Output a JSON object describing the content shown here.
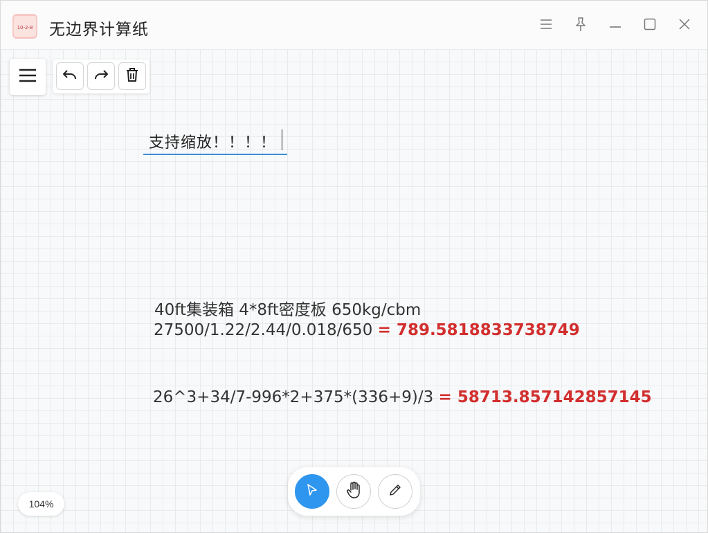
{
  "window": {
    "title": "无边界计算纸",
    "icon_text": "10-2-8"
  },
  "title_buttons": [
    "menu-icon",
    "pin-icon",
    "minimize-icon",
    "maximize-icon",
    "close-icon"
  ],
  "toolbar": [
    "undo-icon",
    "redo-icon",
    "trash-icon"
  ],
  "canvas": {
    "editing_text": "支持缩放！！！！",
    "lines": [
      {
        "expr": "40ft集装箱 4*8ft密度板 650kg/cbm",
        "result": ""
      },
      {
        "expr": "27500/1.22/2.44/0.018/650",
        "result": "= 789.5818833738749"
      },
      {
        "expr": "26^3+34/7-996*2+375*(336+9)/3",
        "result": "= 58713.857142857145"
      }
    ]
  },
  "zoom": "104%",
  "tools": [
    {
      "name": "select",
      "icon": "cursor-icon",
      "active": true
    },
    {
      "name": "pan",
      "icon": "hand-icon",
      "active": false
    },
    {
      "name": "pen",
      "icon": "pencil-icon",
      "active": false
    }
  ],
  "colors": {
    "accent": "#2e96ee",
    "result": "#d22e2e",
    "underline": "#3d8fd6"
  }
}
